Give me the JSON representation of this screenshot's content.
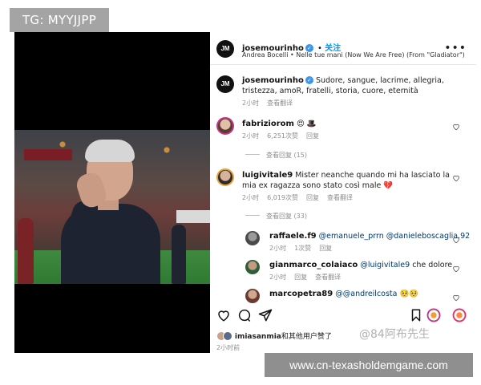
{
  "watermark_top": "TG: MYYJJPP",
  "header": {
    "username": "josemourinho",
    "follow_label": "关注",
    "music": "Andrea Bocelli • Nelle tue mani (Now We Are Free) (From \"Gladiator\")",
    "more_label": "•••",
    "avatar_text": "JM"
  },
  "caption": {
    "username": "josemourinho",
    "text": "Sudore, sangue, lacrime, allegria, tristezza, amoR, fratelli, storia, cuore, eternità",
    "time": "2小时",
    "translate": "查看翻译"
  },
  "comments": [
    {
      "username": "fabriziorom",
      "text": "😍 🎩",
      "time": "2小时",
      "likes": "6,251次赞",
      "reply": "回复",
      "view_replies": "查看回复 (15)"
    },
    {
      "username": "luigivitale9",
      "text": "Mister neanche quando mi ha lasciato la mia ex ragazza sono stato così male 💔",
      "time": "2小时",
      "likes": "6,019次赞",
      "reply": "回复",
      "translate": "查看翻译",
      "view_replies": "查看回复 (33)"
    }
  ],
  "replies": [
    {
      "username": "raffaele.f9",
      "mention_a": "@emanuele_prrn",
      "mention_b": "@danieleboscaglia.92",
      "time": "2小时",
      "likes": "1次赞",
      "reply": "回复"
    },
    {
      "username": "gianmarco_colaiaco",
      "mention": "@luigivitale9",
      "text": "che dolore",
      "time": "2小时",
      "reply": "回复",
      "translate": "查看翻译"
    },
    {
      "username": "marcopetra89",
      "mention": "@@andreilcosta",
      "text": "🥺🥺"
    }
  ],
  "footer": {
    "liked_by_user": "imiasanmia",
    "liked_by_text": "和其他用户赞了",
    "time": "2小时前"
  },
  "watermarks": {
    "weibo": "@84阿布先生",
    "site": "www.cn-texasholdemgame.com"
  },
  "colors": {
    "accent_blue": "#0095f6",
    "verified_blue": "#3897f0",
    "meta_gray": "#8e8e8e",
    "mention_blue": "#00376b"
  },
  "icons": [
    "heart-icon",
    "comment-icon",
    "share-icon",
    "bookmark-icon",
    "more-icon",
    "verified-icon"
  ]
}
